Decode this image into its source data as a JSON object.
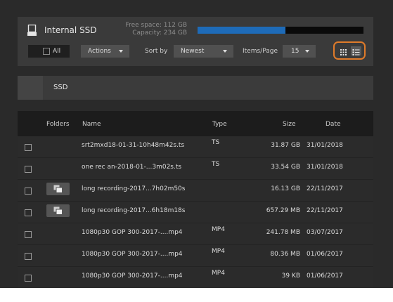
{
  "storage": {
    "name": "Internal SSD",
    "free_space": "Free space: 112 GB",
    "capacity": "Capacity: 234 GB",
    "used_fraction": 0.53,
    "bar_color": "#1e6bb8"
  },
  "toolbar": {
    "all_label": "All",
    "actions_label": "Actions",
    "sort_by_label": "Sort by",
    "sort_value": "Newest",
    "items_per_page_label": "Items/Page",
    "items_per_page_value": "15",
    "view_toggle_highlight": "#e07b2a",
    "icons": {
      "grid_view": "grid-view-icon",
      "list_view": "list-view-icon"
    }
  },
  "location": {
    "label": "SSD"
  },
  "table": {
    "columns": {
      "folders": "Folders",
      "name": "Name",
      "type": "Type",
      "size": "Size",
      "date": "Date"
    },
    "rows": [
      {
        "name": "srt2mxd18-01-31-10h48m42s.ts",
        "type": "TS",
        "size": "31.87 GB",
        "date": "31/01/2018",
        "folder": false
      },
      {
        "name": "one rec an-2018-01-...3m02s.ts",
        "type": "TS",
        "size": "33.54 GB",
        "date": "31/01/2018",
        "folder": false
      },
      {
        "name": "long recording-2017...7h02m50s",
        "type": "",
        "size": "16.13 GB",
        "date": "22/11/2017",
        "folder": true
      },
      {
        "name": "long recording-2017...6h18m18s",
        "type": "",
        "size": "657.29 MB",
        "date": "22/11/2017",
        "folder": true
      },
      {
        "name": "1080p30 GOP 300-2017-....mp4",
        "type": "MP4",
        "size": "241.78 MB",
        "date": "03/07/2017",
        "folder": false
      },
      {
        "name": "1080p30 GOP 300-2017-....mp4",
        "type": "MP4",
        "size": "80.36 MB",
        "date": "01/06/2017",
        "folder": false
      },
      {
        "name": "1080p30 GOP 300-2017-....mp4",
        "type": "MP4",
        "size": "39 KB",
        "date": "01/06/2017",
        "folder": false
      }
    ]
  }
}
